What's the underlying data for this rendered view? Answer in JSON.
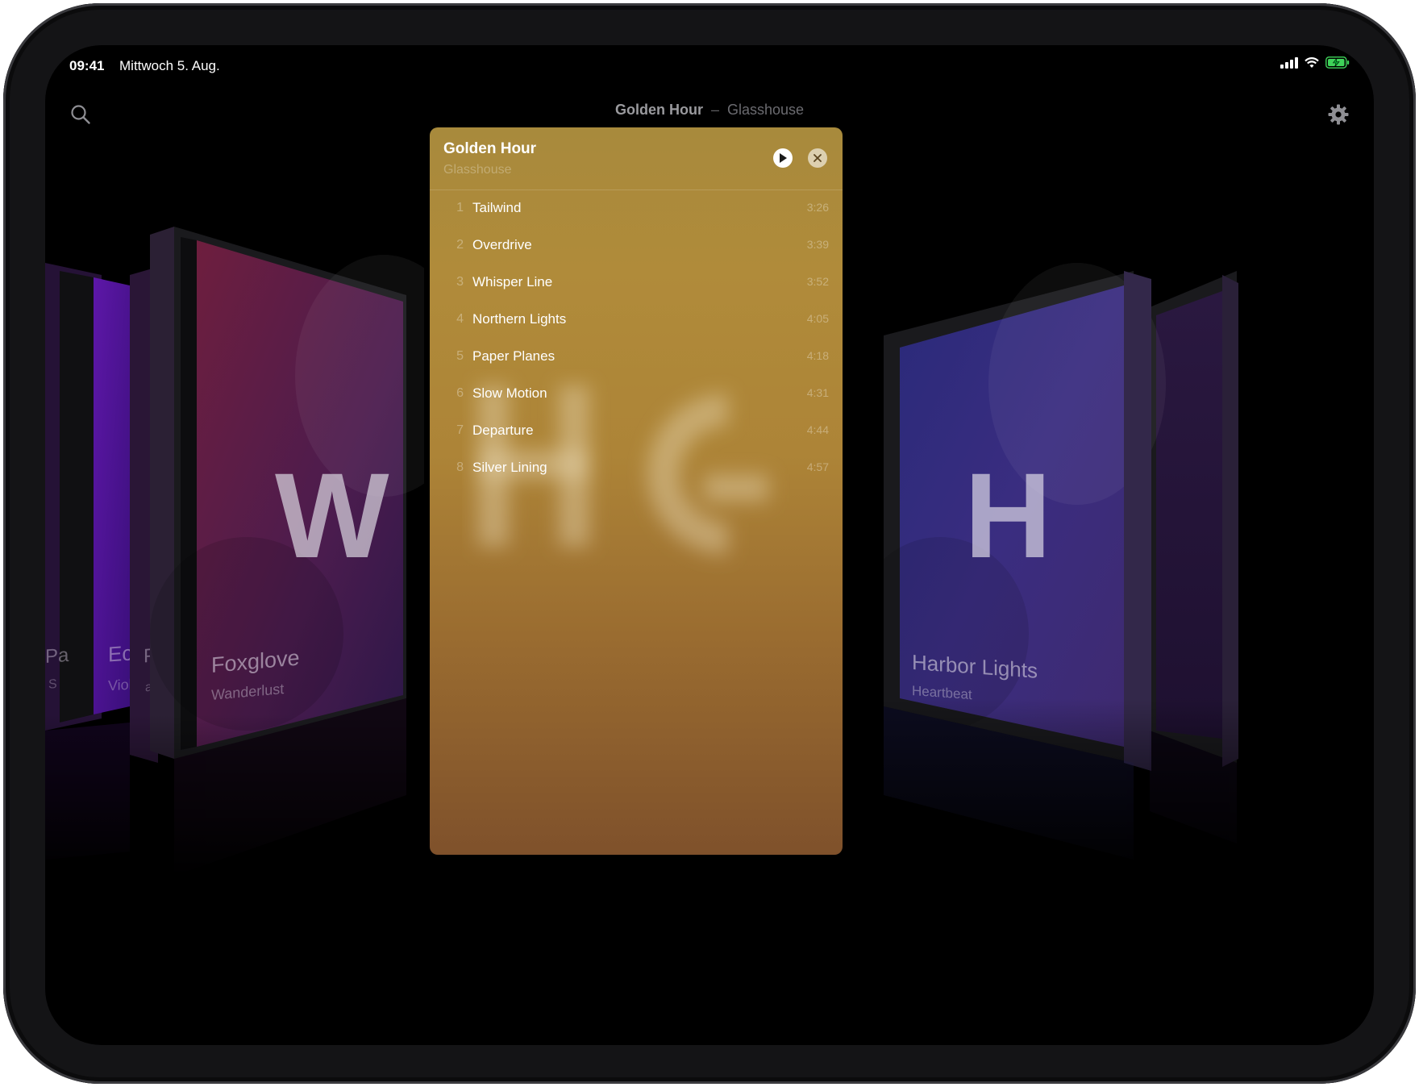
{
  "status": {
    "time": "09:41",
    "date": "Mittwoch 5. Aug."
  },
  "header": {
    "title": "Golden Hour",
    "separator": "–",
    "artist": "Glasshouse"
  },
  "panel": {
    "title": "Golden Hour",
    "artist": "Glasshouse",
    "tracks": [
      {
        "number": "1",
        "name": "Tailwind",
        "duration": "3:26"
      },
      {
        "number": "2",
        "name": "Overdrive",
        "duration": "3:39"
      },
      {
        "number": "3",
        "name": "Whisper Line",
        "duration": "3:52"
      },
      {
        "number": "4",
        "name": "Northern Lights",
        "duration": "4:05"
      },
      {
        "number": "5",
        "name": "Paper Planes",
        "duration": "4:18"
      },
      {
        "number": "6",
        "name": "Slow Motion",
        "duration": "4:31"
      },
      {
        "number": "7",
        "name": "Departure",
        "duration": "4:44"
      },
      {
        "number": "8",
        "name": "Silver Lining",
        "duration": "4:57"
      }
    ]
  },
  "covers": {
    "left_far": {
      "title": "Echo Park",
      "artist": "Violet Skies",
      "visible_title": "Ech",
      "visible_artist": "Viole"
    },
    "left_far2": {
      "visible_title": "Pa",
      "visible_artist": "S"
    },
    "left_mid_edge": {
      "visible_title": "Pa",
      "visible_artist": "ati"
    },
    "left_near": {
      "letter": "W",
      "title": "Foxglove",
      "artist": "Wanderlust"
    },
    "right_near": {
      "letter": "H",
      "title": "Harbor Lights",
      "artist": "Heartbeat"
    }
  },
  "colors": {
    "accent": "#b08b3a",
    "background": "#000000"
  },
  "icons": {
    "search": "search-icon",
    "settings": "gear-icon",
    "play": "play-icon",
    "close": "close-icon"
  }
}
